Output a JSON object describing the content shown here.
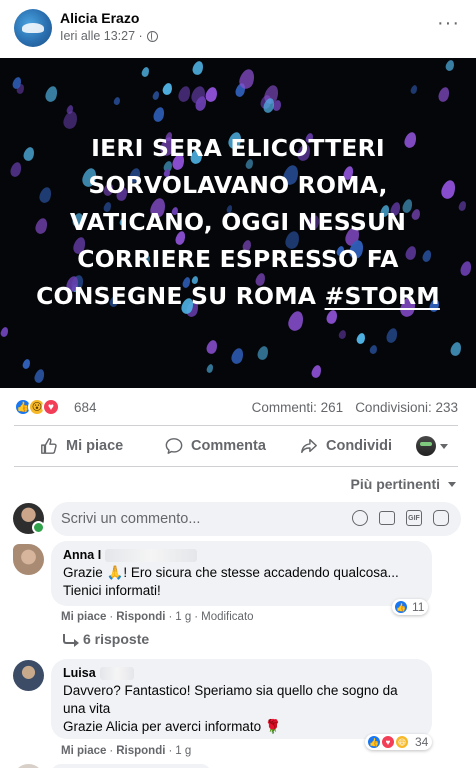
{
  "post": {
    "author": "Alicia Erazo",
    "timestamp": "Ieri alle 13:27 ·",
    "privacy_icon": "globe-icon",
    "more_icon": "more-options-icon",
    "more_label": "···"
  },
  "media": {
    "lines": [
      "IERI SERA ELICOTTERI",
      "SORVOLAVANO ROMA,",
      "VATICANO, OGGI NESSUN",
      "CORRIERE ESPRESSO FA",
      "CONSEGNE SU ROMA"
    ],
    "hashtag": "#STORM",
    "background_color": "#05060a",
    "drop_colors": [
      "#6a3fb0",
      "#2f5fb8",
      "#4fb2e3",
      "#8a4fd0"
    ]
  },
  "stats": {
    "reaction_icons": [
      "like",
      "wow",
      "love"
    ],
    "reaction_count": "684",
    "comments": "Commenti: 261",
    "shares": "Condivisioni: 233"
  },
  "actions": {
    "like": "Mi piace",
    "comment": "Commenta",
    "share": "Condividi"
  },
  "sort": {
    "label": "Più pertinenti"
  },
  "comment_input": {
    "placeholder": "Scrivi un commento..."
  },
  "comments": [
    {
      "name": "Anna I",
      "text_line1": "Grazie 🙏! Ero sicura che stesse accadendo qualcosa...",
      "text_line2": "Tienici informati!",
      "reaction_count": "11",
      "like": "Mi piace",
      "reply": "Rispondi",
      "age": "1 g",
      "edited": "Modificato",
      "replies": "6 risposte"
    },
    {
      "name": "Luisa",
      "text_line1": "Davvero? Fantastico! Speriamo sia quello che sogno da",
      "text_line2": "una vita",
      "text_line3": "Grazie Alicia per averci informato 🌹",
      "reaction_count": "34",
      "like": "Mi piace",
      "reply": "Rispondi",
      "age": "1 g"
    }
  ],
  "colors": {
    "accent": "#1877f2",
    "love": "#f33e58",
    "wow": "#f7b928",
    "secondary_text": "#65676b",
    "bubble_bg": "#f0f2f5"
  }
}
